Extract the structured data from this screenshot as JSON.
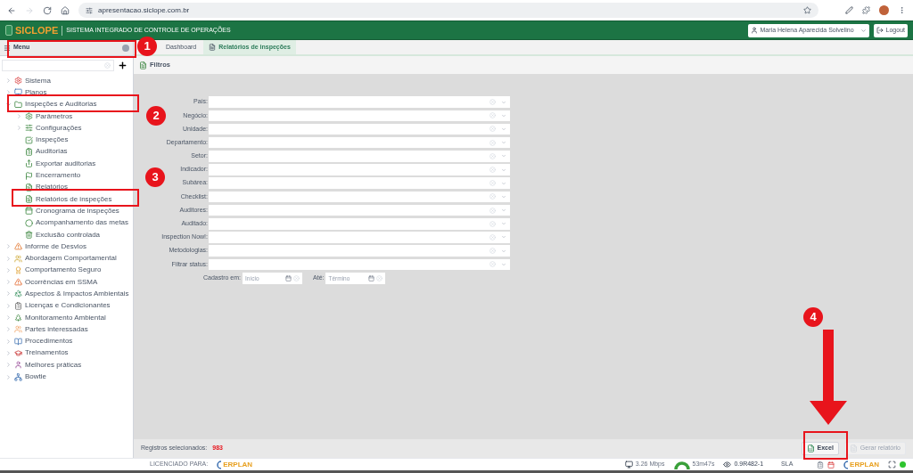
{
  "browser": {
    "url": "apresentacao.siclope.com.br"
  },
  "header": {
    "logo": "SICLOPE",
    "title": "SISTEMA INTEGRADO DE CONTROLE DE OPERAÇÕES",
    "user": "Maria Helena Aparecida Solvelino",
    "logout": "Logout"
  },
  "sidebar": {
    "title": "Menu",
    "items": [
      {
        "label": "Sistema",
        "expanded": false
      },
      {
        "label": "Planos",
        "expanded": false
      },
      {
        "label": "Inspeções e Auditorias",
        "expanded": true,
        "children": [
          {
            "label": "Parâmetros",
            "expanded": false
          },
          {
            "label": "Configurações",
            "expanded": false
          },
          {
            "label": "Inspeções"
          },
          {
            "label": "Auditorias"
          },
          {
            "label": "Exportar auditorias"
          },
          {
            "label": "Encerramento"
          },
          {
            "label": "Relatórios"
          },
          {
            "label": "Relatórios de inspeções"
          },
          {
            "label": "Cronograma de inspeções"
          },
          {
            "label": "Acompanhamento das metas"
          },
          {
            "label": "Exclusão controlada"
          }
        ]
      },
      {
        "label": "Informe de Desvios",
        "expanded": false
      },
      {
        "label": "Abordagem Comportamental",
        "expanded": false
      },
      {
        "label": "Comportamento Seguro",
        "expanded": false
      },
      {
        "label": "Ocorrências em SSMA",
        "expanded": false
      },
      {
        "label": "Aspectos & Impactos Ambientais",
        "expanded": false
      },
      {
        "label": "Licenças e Condicionantes",
        "expanded": false
      },
      {
        "label": "Monitoramento Ambiental",
        "expanded": false
      },
      {
        "label": "Partes interessadas",
        "expanded": false
      },
      {
        "label": "Procedimentos",
        "expanded": false
      },
      {
        "label": "Treinamentos",
        "expanded": false
      },
      {
        "label": "Melhores práticas",
        "expanded": false
      },
      {
        "label": "Bowtie",
        "expanded": false
      }
    ]
  },
  "tabs": [
    {
      "label": "Dashboard",
      "selected": false
    },
    {
      "label": "Relatórios de inspeções",
      "selected": true
    }
  ],
  "filters": {
    "title": "Filtros",
    "fields": [
      {
        "label": "País:"
      },
      {
        "label": "Negócio:"
      },
      {
        "label": "Unidade:"
      },
      {
        "label": "Departamento:"
      },
      {
        "label": "Setor:"
      },
      {
        "label": "Indicador:"
      },
      {
        "label": "Subárea:"
      },
      {
        "label": "Checklist:"
      },
      {
        "label": "Auditores:"
      },
      {
        "label": "Auditado:"
      },
      {
        "label": "Inspection Now!:"
      },
      {
        "label": "Metodologias:"
      },
      {
        "label": "Filtrar status:"
      }
    ],
    "date_from": {
      "label": "Cadastro em:",
      "placeholder": "Início"
    },
    "date_to": {
      "label": "Até:",
      "placeholder": "Término"
    }
  },
  "footer": {
    "records_label": "Registros selecionados:",
    "records_count": "983",
    "buttons": [
      {
        "label": "Excel",
        "disabled": false
      },
      {
        "label": "Gerar relatório",
        "disabled": true
      }
    ]
  },
  "status_bar": {
    "licensed_label": "LICENCIADO PARA:",
    "logo": "ERPLAN",
    "speed": "3.26 Mbps",
    "time": "53m47s",
    "version": "0.9R482-1",
    "sla": "SLA",
    "logo_right": "ERPLAN"
  },
  "annotations": [
    {
      "number": "1"
    },
    {
      "number": "2"
    },
    {
      "number": "3"
    },
    {
      "number": "4"
    }
  ]
}
